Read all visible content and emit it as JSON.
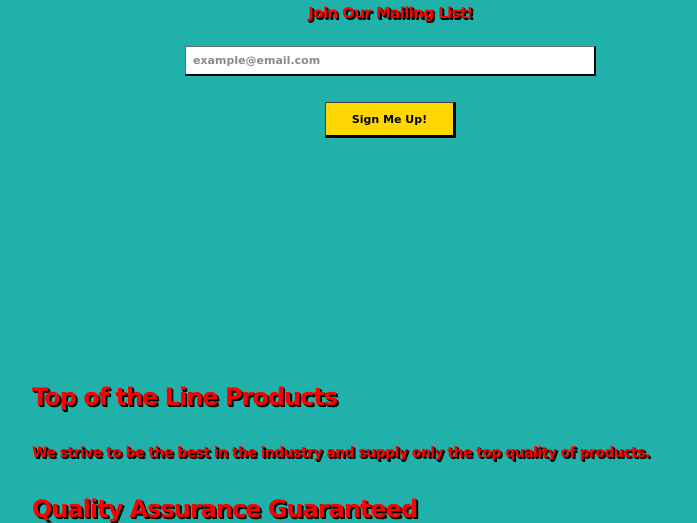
{
  "mailing_list": {
    "title": "Join Our Mailing List!",
    "email_placeholder": "example@email.com",
    "email_value": "",
    "button_label": "Sign Me Up!"
  },
  "features": [
    {
      "heading": "Top of the Line Products",
      "text": "We strive to be the best in the industry and supply only the top quality of products."
    },
    {
      "heading": "Quality Assurance Guaranteed"
    }
  ],
  "colors": {
    "background": "#20b2aa",
    "heading_text": "#ff0000",
    "button": "#ffd700",
    "text_shadow": "#000000"
  }
}
